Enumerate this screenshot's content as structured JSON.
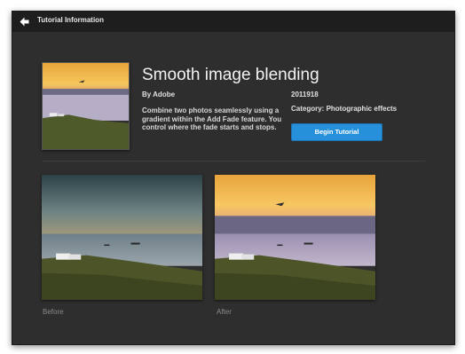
{
  "header": {
    "title": "Tutorial Information",
    "back_icon": "back-arrow-icon"
  },
  "tutorial": {
    "title": "Smooth image blending",
    "author": "By Adobe",
    "description": "Combine two photos seamlessly using a gradient within the Add Fade feature. You control where the fade starts and stops.",
    "id": "2011918",
    "category": "Category: Photographic effects",
    "begin_label": "Begin Tutorial"
  },
  "comparison": {
    "before_label": "Before",
    "after_label": "After"
  },
  "colors": {
    "accent": "#2790db",
    "background": "#2e2e2e",
    "topbar": "#1e1e1e"
  }
}
